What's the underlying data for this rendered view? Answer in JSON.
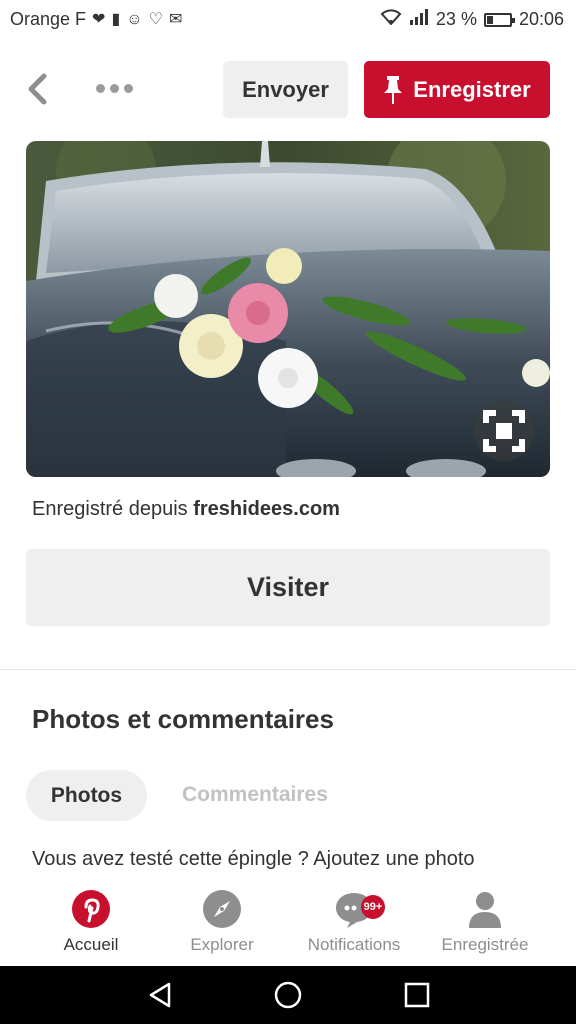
{
  "status_bar": {
    "carrier": "Orange F",
    "battery_percent": "23 %",
    "battery_level": 0.23,
    "time": "20:06",
    "icons": [
      "heart-pulse-icon",
      "alert-icon",
      "cartoon-icon",
      "heart-outline-icon",
      "mail-icon",
      "wifi-icon",
      "signal-icon",
      "battery-icon"
    ]
  },
  "toolbar": {
    "send_label": "Envoyer",
    "save_label": "Enregistrer"
  },
  "pin": {
    "source_prefix": "Enregistré depuis",
    "source_domain": "freshidees.com",
    "visit_label": "Visiter"
  },
  "comments_section": {
    "title": "Photos et commentaires",
    "tabs": [
      {
        "label": "Photos",
        "selected": true
      },
      {
        "label": "Commentaires",
        "selected": false
      }
    ],
    "prompt": "Vous avez testé cette épingle ? Ajoutez une photo"
  },
  "bottom_nav": {
    "items": [
      {
        "label": "Accueil",
        "icon": "pinterest-logo-icon",
        "active": true
      },
      {
        "label": "Explorer",
        "icon": "compass-icon",
        "active": false
      },
      {
        "label": "Notifications",
        "icon": "chat-bubble-icon",
        "badge": "99+",
        "active": false
      },
      {
        "label": "Enregistrée",
        "icon": "person-icon",
        "active": false
      }
    ]
  },
  "colors": {
    "brand_red": "#c8102e",
    "button_gray": "#efefef",
    "inactive_text": "#8e8e8e"
  }
}
